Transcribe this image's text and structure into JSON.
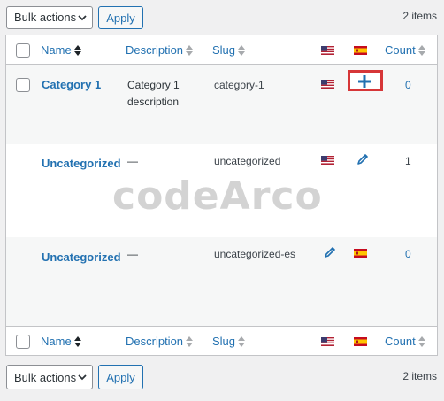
{
  "toolbar_top": {
    "bulk_actions": "Bulk actions",
    "apply": "Apply",
    "items": "2 items"
  },
  "toolbar_bottom": {
    "bulk_actions": "Bulk actions",
    "apply": "Apply",
    "items": "2 items"
  },
  "columns": {
    "name": "Name",
    "description": "Description",
    "slug": "Slug",
    "count": "Count"
  },
  "languages": [
    {
      "name": "English",
      "flag": "us-flag-icon"
    },
    {
      "name": "Spanish",
      "flag": "spain-flag-icon"
    }
  ],
  "rows": [
    {
      "name": "Category 1",
      "description": "Category 1 description",
      "slug": "category-1",
      "count": "0",
      "en_action": "us-flag-icon",
      "es_action": "add-translation-icon"
    },
    {
      "name": "Uncategorized",
      "description": "—",
      "slug": "uncategorized",
      "count": "1",
      "en_action": "us-flag-icon",
      "es_action": "edit-pencil-icon"
    },
    {
      "name": "Uncategorized",
      "description": "—",
      "slug": "uncategorized-es",
      "count": "0",
      "en_action": "edit-pencil-icon",
      "es_action": "spain-flag-icon"
    }
  ],
  "watermark": "codeArco",
  "colors": {
    "link": "#2271b1",
    "highlight_border": "#d63638",
    "table_border": "#c3c4c7"
  }
}
